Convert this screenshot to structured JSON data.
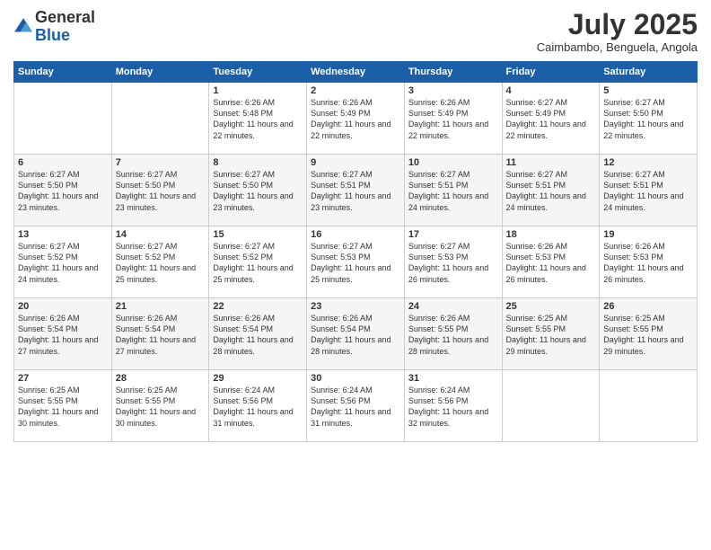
{
  "header": {
    "logo_line1": "General",
    "logo_line2": "Blue",
    "month_title": "July 2025",
    "location": "Caimbambo, Benguela, Angola"
  },
  "days_of_week": [
    "Sunday",
    "Monday",
    "Tuesday",
    "Wednesday",
    "Thursday",
    "Friday",
    "Saturday"
  ],
  "weeks": [
    [
      {
        "day": "",
        "sunrise": "",
        "sunset": "",
        "daylight": ""
      },
      {
        "day": "",
        "sunrise": "",
        "sunset": "",
        "daylight": ""
      },
      {
        "day": "1",
        "sunrise": "Sunrise: 6:26 AM",
        "sunset": "Sunset: 5:48 PM",
        "daylight": "Daylight: 11 hours and 22 minutes."
      },
      {
        "day": "2",
        "sunrise": "Sunrise: 6:26 AM",
        "sunset": "Sunset: 5:49 PM",
        "daylight": "Daylight: 11 hours and 22 minutes."
      },
      {
        "day": "3",
        "sunrise": "Sunrise: 6:26 AM",
        "sunset": "Sunset: 5:49 PM",
        "daylight": "Daylight: 11 hours and 22 minutes."
      },
      {
        "day": "4",
        "sunrise": "Sunrise: 6:27 AM",
        "sunset": "Sunset: 5:49 PM",
        "daylight": "Daylight: 11 hours and 22 minutes."
      },
      {
        "day": "5",
        "sunrise": "Sunrise: 6:27 AM",
        "sunset": "Sunset: 5:50 PM",
        "daylight": "Daylight: 11 hours and 22 minutes."
      }
    ],
    [
      {
        "day": "6",
        "sunrise": "Sunrise: 6:27 AM",
        "sunset": "Sunset: 5:50 PM",
        "daylight": "Daylight: 11 hours and 23 minutes."
      },
      {
        "day": "7",
        "sunrise": "Sunrise: 6:27 AM",
        "sunset": "Sunset: 5:50 PM",
        "daylight": "Daylight: 11 hours and 23 minutes."
      },
      {
        "day": "8",
        "sunrise": "Sunrise: 6:27 AM",
        "sunset": "Sunset: 5:50 PM",
        "daylight": "Daylight: 11 hours and 23 minutes."
      },
      {
        "day": "9",
        "sunrise": "Sunrise: 6:27 AM",
        "sunset": "Sunset: 5:51 PM",
        "daylight": "Daylight: 11 hours and 23 minutes."
      },
      {
        "day": "10",
        "sunrise": "Sunrise: 6:27 AM",
        "sunset": "Sunset: 5:51 PM",
        "daylight": "Daylight: 11 hours and 24 minutes."
      },
      {
        "day": "11",
        "sunrise": "Sunrise: 6:27 AM",
        "sunset": "Sunset: 5:51 PM",
        "daylight": "Daylight: 11 hours and 24 minutes."
      },
      {
        "day": "12",
        "sunrise": "Sunrise: 6:27 AM",
        "sunset": "Sunset: 5:51 PM",
        "daylight": "Daylight: 11 hours and 24 minutes."
      }
    ],
    [
      {
        "day": "13",
        "sunrise": "Sunrise: 6:27 AM",
        "sunset": "Sunset: 5:52 PM",
        "daylight": "Daylight: 11 hours and 24 minutes."
      },
      {
        "day": "14",
        "sunrise": "Sunrise: 6:27 AM",
        "sunset": "Sunset: 5:52 PM",
        "daylight": "Daylight: 11 hours and 25 minutes."
      },
      {
        "day": "15",
        "sunrise": "Sunrise: 6:27 AM",
        "sunset": "Sunset: 5:52 PM",
        "daylight": "Daylight: 11 hours and 25 minutes."
      },
      {
        "day": "16",
        "sunrise": "Sunrise: 6:27 AM",
        "sunset": "Sunset: 5:53 PM",
        "daylight": "Daylight: 11 hours and 25 minutes."
      },
      {
        "day": "17",
        "sunrise": "Sunrise: 6:27 AM",
        "sunset": "Sunset: 5:53 PM",
        "daylight": "Daylight: 11 hours and 26 minutes."
      },
      {
        "day": "18",
        "sunrise": "Sunrise: 6:26 AM",
        "sunset": "Sunset: 5:53 PM",
        "daylight": "Daylight: 11 hours and 26 minutes."
      },
      {
        "day": "19",
        "sunrise": "Sunrise: 6:26 AM",
        "sunset": "Sunset: 5:53 PM",
        "daylight": "Daylight: 11 hours and 26 minutes."
      }
    ],
    [
      {
        "day": "20",
        "sunrise": "Sunrise: 6:26 AM",
        "sunset": "Sunset: 5:54 PM",
        "daylight": "Daylight: 11 hours and 27 minutes."
      },
      {
        "day": "21",
        "sunrise": "Sunrise: 6:26 AM",
        "sunset": "Sunset: 5:54 PM",
        "daylight": "Daylight: 11 hours and 27 minutes."
      },
      {
        "day": "22",
        "sunrise": "Sunrise: 6:26 AM",
        "sunset": "Sunset: 5:54 PM",
        "daylight": "Daylight: 11 hours and 28 minutes."
      },
      {
        "day": "23",
        "sunrise": "Sunrise: 6:26 AM",
        "sunset": "Sunset: 5:54 PM",
        "daylight": "Daylight: 11 hours and 28 minutes."
      },
      {
        "day": "24",
        "sunrise": "Sunrise: 6:26 AM",
        "sunset": "Sunset: 5:55 PM",
        "daylight": "Daylight: 11 hours and 28 minutes."
      },
      {
        "day": "25",
        "sunrise": "Sunrise: 6:25 AM",
        "sunset": "Sunset: 5:55 PM",
        "daylight": "Daylight: 11 hours and 29 minutes."
      },
      {
        "day": "26",
        "sunrise": "Sunrise: 6:25 AM",
        "sunset": "Sunset: 5:55 PM",
        "daylight": "Daylight: 11 hours and 29 minutes."
      }
    ],
    [
      {
        "day": "27",
        "sunrise": "Sunrise: 6:25 AM",
        "sunset": "Sunset: 5:55 PM",
        "daylight": "Daylight: 11 hours and 30 minutes."
      },
      {
        "day": "28",
        "sunrise": "Sunrise: 6:25 AM",
        "sunset": "Sunset: 5:55 PM",
        "daylight": "Daylight: 11 hours and 30 minutes."
      },
      {
        "day": "29",
        "sunrise": "Sunrise: 6:24 AM",
        "sunset": "Sunset: 5:56 PM",
        "daylight": "Daylight: 11 hours and 31 minutes."
      },
      {
        "day": "30",
        "sunrise": "Sunrise: 6:24 AM",
        "sunset": "Sunset: 5:56 PM",
        "daylight": "Daylight: 11 hours and 31 minutes."
      },
      {
        "day": "31",
        "sunrise": "Sunrise: 6:24 AM",
        "sunset": "Sunset: 5:56 PM",
        "daylight": "Daylight: 11 hours and 32 minutes."
      },
      {
        "day": "",
        "sunrise": "",
        "sunset": "",
        "daylight": ""
      },
      {
        "day": "",
        "sunrise": "",
        "sunset": "",
        "daylight": ""
      }
    ]
  ]
}
